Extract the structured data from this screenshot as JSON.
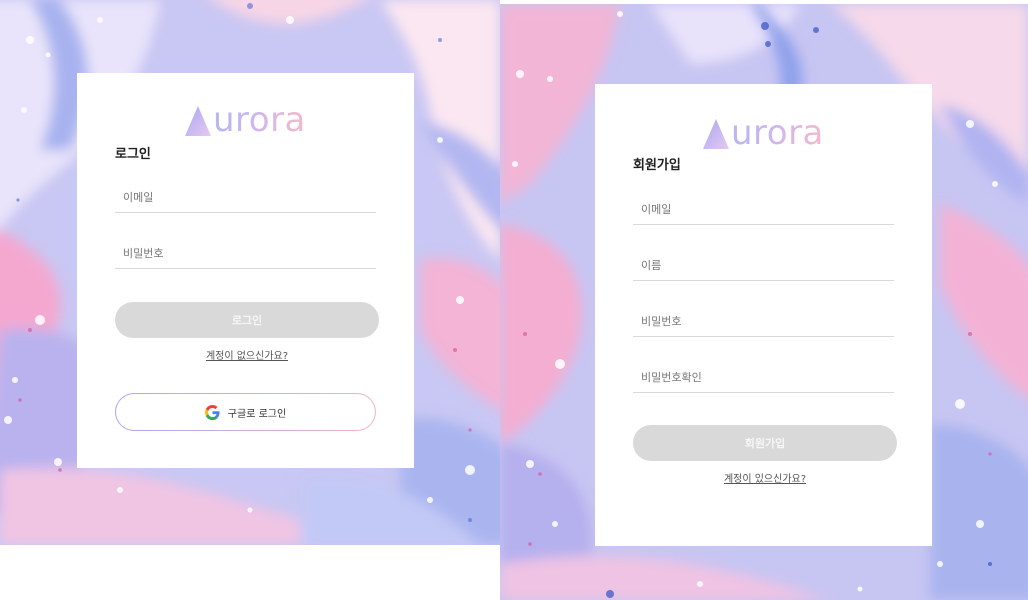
{
  "brand": {
    "name": "urora",
    "colors": {
      "gradient_start": "#b7b6f2",
      "gradient_end": "#f5b9c9"
    }
  },
  "login": {
    "title": "로그인",
    "email_placeholder": "이메일",
    "password_placeholder": "비밀번호",
    "submit_label": "로그인",
    "signup_link": "계정이 없으신가요?",
    "google_label": "구글로 로그인",
    "google_icon": "google-icon"
  },
  "signup": {
    "title": "회원가입",
    "email_placeholder": "이메일",
    "name_placeholder": "이름",
    "password_placeholder": "비밀번호",
    "password_confirm_placeholder": "비밀번호확인",
    "submit_label": "회원가입",
    "login_link": "계정이 있으신가요?"
  },
  "colors": {
    "button_disabled": "#d9d9d9",
    "divider": "#d9d9d9",
    "background_pink": "#f2a9cf",
    "background_blue": "#a9b3ef"
  }
}
